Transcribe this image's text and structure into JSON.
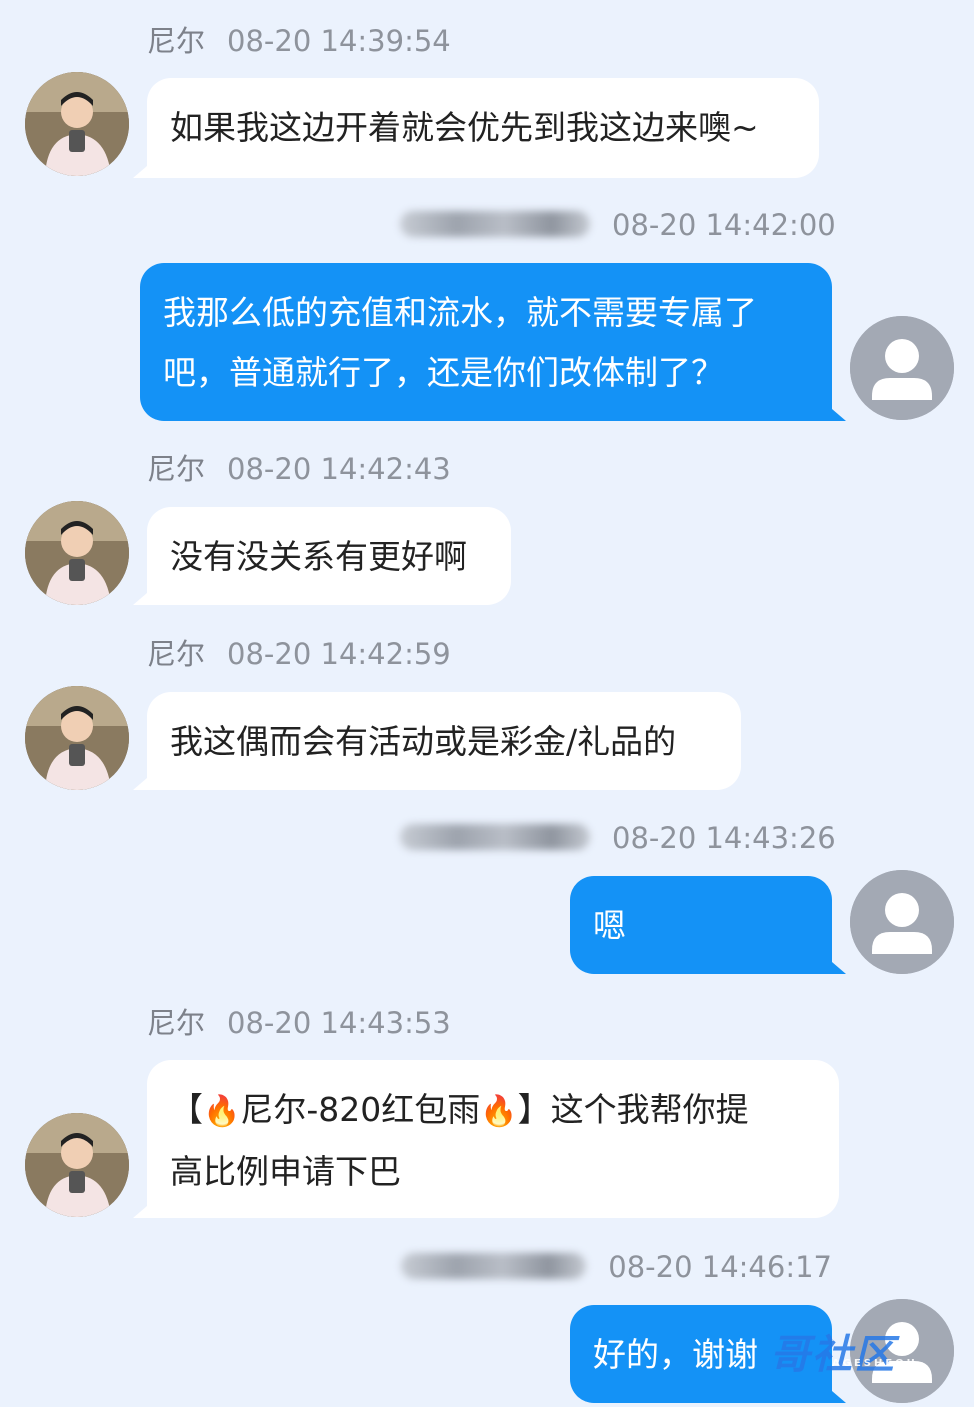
{
  "messages": [
    {
      "sender": "尼尔",
      "time": "08-20 14:39:54",
      "text": "如果我这边开着就会优先到我这边来噢~"
    },
    {
      "time": "08-20 14:42:00",
      "text": "我那么低的充值和流水，就不需要专属了\n吧，普通就行了，还是你们改体制了？"
    },
    {
      "sender": "尼尔",
      "time": "08-20 14:42:43",
      "text": "没有没关系有更好啊"
    },
    {
      "sender": "尼尔",
      "time": "08-20 14:42:59",
      "text": "我这偶而会有活动或是彩金/礼品的"
    },
    {
      "time": "08-20 14:43:26",
      "text": "嗯"
    },
    {
      "sender": "尼尔",
      "time": "08-20 14:43:53",
      "text_a": "【",
      "text_b": "尼尔-820红包雨",
      "text_c": "】这个我帮你提\n高比例申请下巴"
    },
    {
      "time": "08-20 14:46:17",
      "text": "好的，谢谢"
    }
  ],
  "icons": {
    "fire": "🔥"
  },
  "watermark": {
    "main": "哥社区",
    "sub": "AGESHEQU"
  }
}
